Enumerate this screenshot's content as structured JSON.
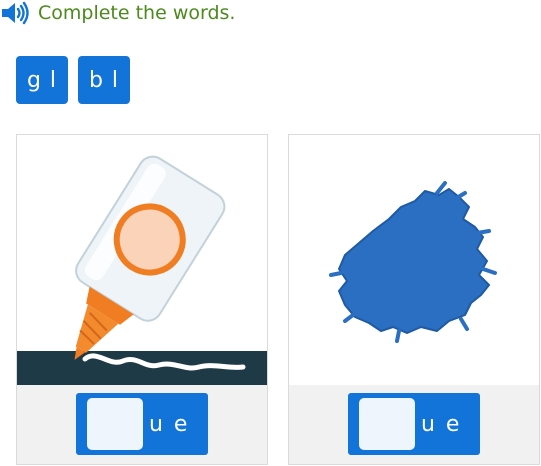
{
  "prompt": {
    "text": "Complete the words.",
    "audio_icon": "speaker-icon"
  },
  "tiles": [
    {
      "label": "g l"
    },
    {
      "label": "b l"
    }
  ],
  "cards": [
    {
      "image": "glue-bottle",
      "blank": "",
      "suffix": "u e"
    },
    {
      "image": "blue-paint-splotch",
      "blank": "",
      "suffix": "u e"
    }
  ],
  "colors": {
    "accent": "#1274d9",
    "prompt_text": "#4c8a1d",
    "blank_fill": "#eef5fd",
    "answer_band": "#f1f1f1",
    "paint_blue": "#2a6fc2"
  }
}
